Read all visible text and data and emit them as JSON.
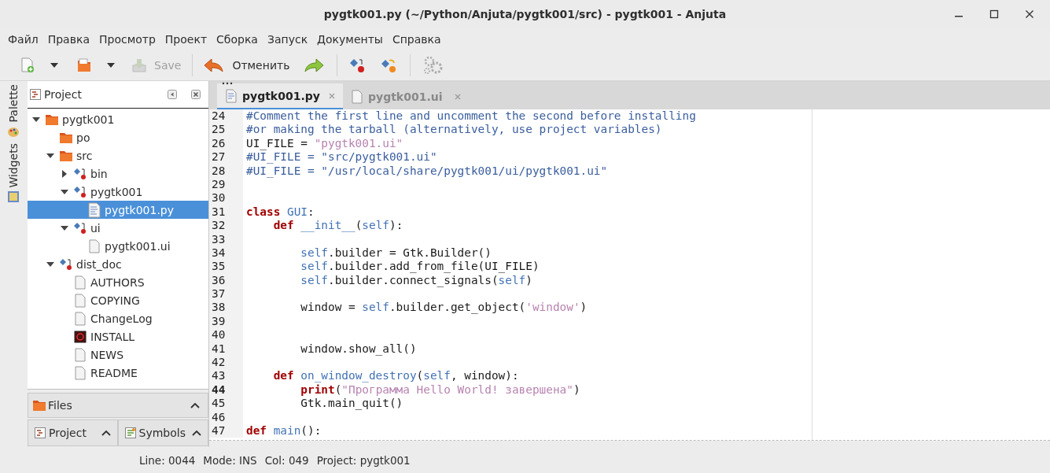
{
  "window": {
    "title": "pygtk001.py (~/Python/Anjuta/pygtk001/src) - pygtk001 - Anjuta"
  },
  "menu": [
    "Файл",
    "Правка",
    "Просмотр",
    "Проект",
    "Сборка",
    "Запуск",
    "Документы",
    "Справка"
  ],
  "toolbar": {
    "save": {
      "label": "Save",
      "disabled": true
    },
    "undo": {
      "label": "Отменить",
      "disabled": false
    }
  },
  "side_tabs": [
    "Palette",
    "Widgets"
  ],
  "project_panel": {
    "title": "Project",
    "tree": [
      {
        "label": "pygtk001",
        "kind": "folder",
        "expanded": true,
        "selected": false,
        "children": [
          {
            "label": "po",
            "kind": "folder",
            "selected": false
          },
          {
            "label": "src",
            "kind": "folder",
            "expanded": true,
            "selected": false,
            "children": [
              {
                "label": "bin",
                "kind": "target",
                "expanded": false,
                "selected": false
              },
              {
                "label": "pygtk001",
                "kind": "target",
                "expanded": true,
                "selected": false,
                "children": [
                  {
                    "label": "pygtk001.py",
                    "kind": "source",
                    "selected": true
                  }
                ]
              },
              {
                "label": "ui",
                "kind": "target",
                "expanded": true,
                "selected": false,
                "children": [
                  {
                    "label": "pygtk001.ui",
                    "kind": "file",
                    "selected": false
                  }
                ]
              }
            ]
          },
          {
            "label": "dist_doc",
            "kind": "target",
            "expanded": true,
            "selected": false,
            "children": [
              {
                "label": "AUTHORS",
                "kind": "file",
                "selected": false
              },
              {
                "label": "COPYING",
                "kind": "file",
                "selected": false
              },
              {
                "label": "ChangeLog",
                "kind": "file",
                "selected": false
              },
              {
                "label": "INSTALL",
                "kind": "install",
                "selected": false
              },
              {
                "label": "NEWS",
                "kind": "file",
                "selected": false
              },
              {
                "label": "README",
                "kind": "file",
                "selected": false
              }
            ]
          }
        ]
      }
    ]
  },
  "files_panel": {
    "title": "Files"
  },
  "bottom_tabs": [
    {
      "label": "Project",
      "kind": "project"
    },
    {
      "label": "Symbols",
      "kind": "symbols"
    }
  ],
  "editor_tabs": [
    {
      "label": "pygtk001.py",
      "selected": true
    },
    {
      "label": "pygtk001.ui",
      "selected": false
    }
  ],
  "code": [
    {
      "num": "24",
      "tokens": [
        {
          "kind": "comment",
          "text": "#Comment the first line and uncomment the second before installing"
        }
      ]
    },
    {
      "num": "25",
      "tokens": [
        {
          "kind": "comment",
          "text": "#or making the tarball (alternatively, use project variables)"
        }
      ]
    },
    {
      "num": "26",
      "tokens": [
        {
          "kind": "plain",
          "text": "UI_FILE = "
        },
        {
          "kind": "string",
          "text": "\"pygtk001.ui\""
        }
      ]
    },
    {
      "num": "27",
      "tokens": [
        {
          "kind": "comment",
          "text": "#UI_FILE = \"src/pygtk001.ui\""
        }
      ]
    },
    {
      "num": "28",
      "tokens": [
        {
          "kind": "comment",
          "text": "#UI_FILE = \"/usr/local/share/pygtk001/ui/pygtk001.ui\""
        }
      ]
    },
    {
      "num": "29"
    },
    {
      "num": "30"
    },
    {
      "num": "31",
      "tokens": [
        {
          "kind": "keyword",
          "text": "class"
        },
        {
          "kind": "name",
          "text": " GUI"
        },
        {
          "kind": "plain",
          "text": ":"
        }
      ]
    },
    {
      "num": "32",
      "tokens": [
        {
          "kind": "keyword",
          "text": "    def"
        },
        {
          "kind": "name",
          "text": " __init__"
        },
        {
          "kind": "plain",
          "text": "("
        },
        {
          "kind": "name",
          "text": "self"
        },
        {
          "kind": "plain",
          "text": "):"
        }
      ]
    },
    {
      "num": "33"
    },
    {
      "num": "34",
      "tokens": [
        {
          "kind": "name",
          "text": "        self"
        },
        {
          "kind": "plain",
          "text": ".builder = Gtk.Builder()"
        }
      ]
    },
    {
      "num": "35",
      "tokens": [
        {
          "kind": "name",
          "text": "        self"
        },
        {
          "kind": "plain",
          "text": ".builder.add_from_file(UI_FILE)"
        }
      ]
    },
    {
      "num": "36",
      "tokens": [
        {
          "kind": "name",
          "text": "        self"
        },
        {
          "kind": "plain",
          "text": ".builder.connect_signals("
        },
        {
          "kind": "name",
          "text": "self"
        },
        {
          "kind": "plain",
          "text": ")"
        }
      ]
    },
    {
      "num": "37"
    },
    {
      "num": "38",
      "tokens": [
        {
          "kind": "plain",
          "text": "        window = "
        },
        {
          "kind": "name",
          "text": "self"
        },
        {
          "kind": "plain",
          "text": ".builder.get_object("
        },
        {
          "kind": "string",
          "text": "'window'"
        },
        {
          "kind": "plain",
          "text": ")"
        }
      ]
    },
    {
      "num": "39"
    },
    {
      "num": "40"
    },
    {
      "num": "41",
      "tokens": [
        {
          "kind": "plain",
          "text": "        window.show_all()"
        }
      ]
    },
    {
      "num": "42"
    },
    {
      "num": "43",
      "tokens": [
        {
          "kind": "keyword",
          "text": "    def"
        },
        {
          "kind": "name",
          "text": " on_window_destroy"
        },
        {
          "kind": "plain",
          "text": "("
        },
        {
          "kind": "name",
          "text": "self"
        },
        {
          "kind": "plain",
          "text": ", window):"
        }
      ]
    },
    {
      "num": "44",
      "current": true,
      "tokens": [
        {
          "kind": "keyword",
          "text": "        print"
        },
        {
          "kind": "plain",
          "text": "("
        },
        {
          "kind": "string",
          "text": "\"Программа Hello World! завершена\""
        },
        {
          "kind": "plain",
          "text": ")"
        }
      ]
    },
    {
      "num": "45",
      "tokens": [
        {
          "kind": "plain",
          "text": "        Gtk.main_quit()"
        }
      ]
    },
    {
      "num": "46"
    },
    {
      "num": "47",
      "tokens": [
        {
          "kind": "keyword",
          "text": "def"
        },
        {
          "kind": "name",
          "text": " main"
        },
        {
          "kind": "plain",
          "text": "():"
        }
      ]
    }
  ],
  "status_bar": [
    "Line: 0044",
    "Mode: INS",
    "Col: 049",
    "Project: pygtk001"
  ]
}
